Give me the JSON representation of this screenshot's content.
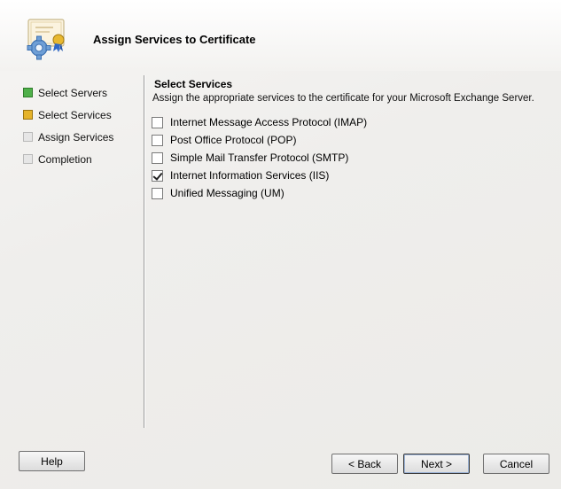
{
  "header": {
    "title": "Assign Services to Certificate",
    "icon": "certificate-gear-icon"
  },
  "steps": [
    {
      "label": "Select Servers",
      "status": "done",
      "color": "#4fb04a"
    },
    {
      "label": "Select Services",
      "status": "current",
      "color": "#e5b32a"
    },
    {
      "label": "Assign Services",
      "status": "pending",
      "color": "#e6e6e6"
    },
    {
      "label": "Completion",
      "status": "pending",
      "color": "#e6e6e6"
    }
  ],
  "main": {
    "section_title": "Select Services",
    "description": "Assign the appropriate services to the certificate for your Microsoft Exchange Server.",
    "services": [
      {
        "label": "Internet Message Access Protocol (IMAP)",
        "checked": false
      },
      {
        "label": "Post Office Protocol (POP)",
        "checked": false
      },
      {
        "label": "Simple Mail Transfer Protocol (SMTP)",
        "checked": false
      },
      {
        "label": "Internet Information Services (IIS)",
        "checked": true
      },
      {
        "label": "Unified Messaging (UM)",
        "checked": false
      }
    ]
  },
  "buttons": {
    "help": "Help",
    "back": "< Back",
    "next": "Next >",
    "cancel": "Cancel"
  }
}
